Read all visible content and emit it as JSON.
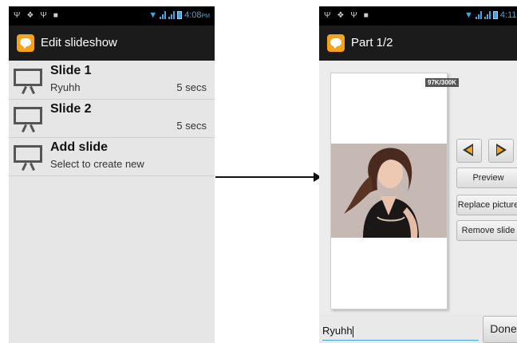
{
  "left_screen": {
    "status_time": "4:08",
    "status_ampm": "PM",
    "title": "Edit slideshow",
    "slides": [
      {
        "title": "Slide 1",
        "subtitle": "Ryuhh",
        "duration": "5 secs"
      },
      {
        "title": "Slide 2",
        "subtitle": "",
        "duration": "5 secs"
      },
      {
        "title": "Add slide",
        "subtitle": "Select to create new",
        "duration": ""
      }
    ]
  },
  "right_screen": {
    "status_time": "4:11",
    "status_ampm": "PM",
    "title": "Part 1/2",
    "size_badge": "97K/300K",
    "buttons": {
      "preview": "Preview",
      "replace": "Replace picture",
      "remove": "Remove slide",
      "done": "Done"
    },
    "text_field_value": "Ryuhh"
  },
  "colors": {
    "status_accent": "#3ea6e8",
    "app_icon": "#f5a31a",
    "title_bar": "#1b1b1b",
    "list_background": "#e6e6e6"
  },
  "icons": [
    "usb-icon",
    "android-icon",
    "photo-icon",
    "wifi-icon",
    "signal-icon",
    "battery-icon",
    "messaging-app-icon",
    "slideshow-board-icon",
    "previous-arrow-icon",
    "next-arrow-icon"
  ]
}
